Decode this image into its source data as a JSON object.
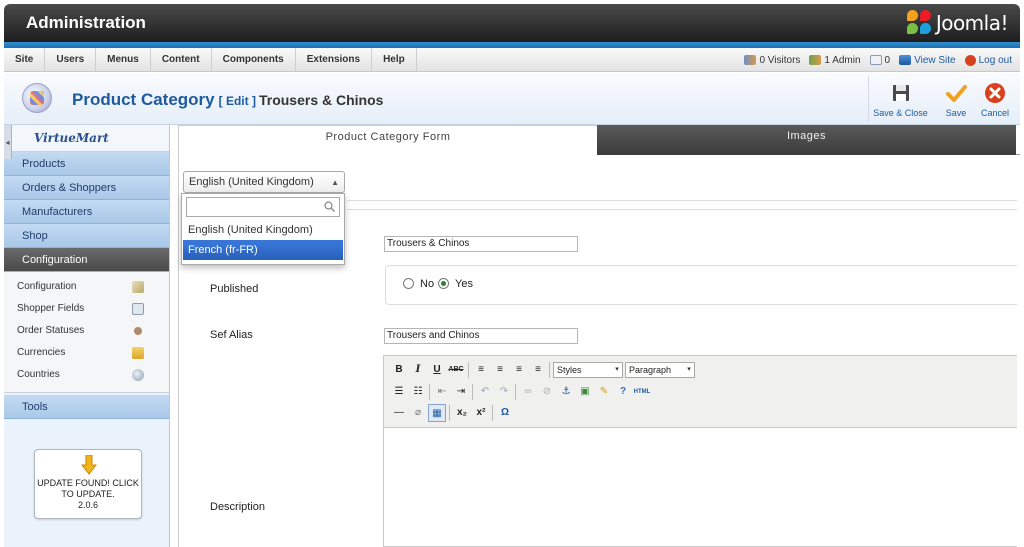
{
  "header": {
    "title": "Administration",
    "logo_text": "Joomla!"
  },
  "menu": [
    "Site",
    "Users",
    "Menus",
    "Content",
    "Components",
    "Extensions",
    "Help"
  ],
  "status": {
    "visitors": "0 Visitors",
    "admins": "1 Admin",
    "messages": "0",
    "view_site": "View Site",
    "logout": "Log out"
  },
  "toolbar": {
    "title": "Product Category",
    "edit_tag": "[ Edit ]",
    "subtitle": "Trousers & Chinos",
    "save_close_label": "Save & Close",
    "save_label": "Save",
    "cancel_label": "Cancel"
  },
  "sidebar": {
    "logo": "VirtueMart",
    "sections": [
      "Products",
      "Orders & Shoppers",
      "Manufacturers",
      "Shop",
      "Configuration"
    ],
    "config_items": [
      "Configuration",
      "Shopper Fields",
      "Order Statuses",
      "Currencies",
      "Countries"
    ],
    "tools": "Tools",
    "update_text": "UPDATE FOUND! CLICK TO UPDATE.",
    "update_version": "2.0.6"
  },
  "tabs": {
    "form": "Product Category Form",
    "images": "Images"
  },
  "language": {
    "selected": "English (United Kingdom)",
    "options": [
      "English (United Kingdom)",
      "French (fr-FR)"
    ],
    "highlighted_index": 1
  },
  "form": {
    "category_name_value": "Trousers & Chinos",
    "published_label": "Published",
    "published_no": "No",
    "published_yes": "Yes",
    "published_value": "Yes",
    "alias_label": "Sef Alias",
    "alias_value": "Trousers and Chinos",
    "description_label": "Description"
  },
  "editor": {
    "styles_label": "Styles",
    "format_label": "Paragraph"
  },
  "colors": {
    "accent": "#1d5a9e",
    "header_dark": "#2b2b2b",
    "blue_strip": "#1f7fc4",
    "highlight": "#3875d7"
  }
}
